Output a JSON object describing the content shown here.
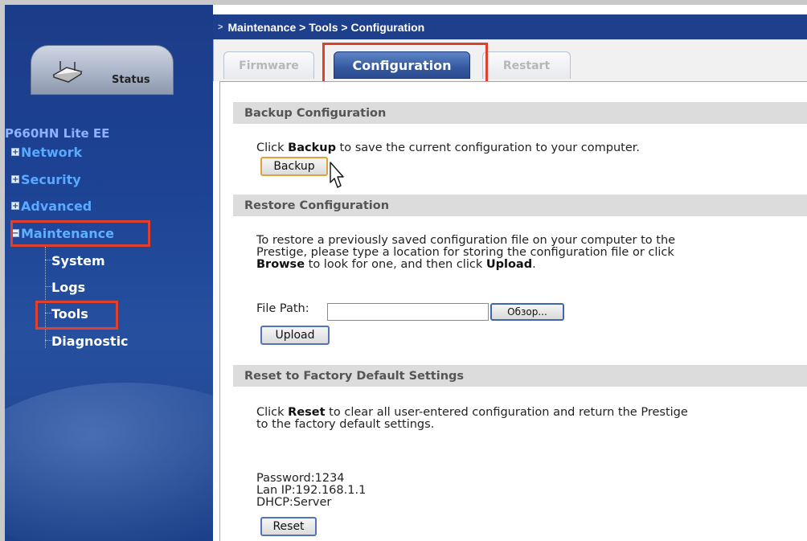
{
  "breadcrumb": "Maintenance > Tools > Configuration",
  "status_tab": {
    "label": "Status",
    "icon": "router-icon"
  },
  "sidebar": {
    "device_name": "P660HN Lite EE",
    "items": [
      {
        "label": "Network"
      },
      {
        "label": "Security"
      },
      {
        "label": "Advanced"
      },
      {
        "label": "Maintenance"
      }
    ],
    "subitems": [
      {
        "label": "System"
      },
      {
        "label": "Logs"
      },
      {
        "label": "Tools"
      },
      {
        "label": "Diagnostic"
      }
    ]
  },
  "tabs": [
    {
      "label": "Firmware",
      "active": false
    },
    {
      "label": "Configuration",
      "active": true
    },
    {
      "label": "Restart",
      "active": false
    }
  ],
  "backup": {
    "header": "Backup Configuration",
    "text_pre": "Click ",
    "text_bold": "Backup",
    "text_post": " to save the current configuration to your computer.",
    "button": "Backup"
  },
  "restore": {
    "header": "Restore Configuration",
    "line1": "To restore a previously saved configuration file on your computer to the",
    "line2": "Prestige, please type a location for storing the configuration file or click",
    "line3_bold1": "Browse",
    "line3_mid": " to look for one, and then click ",
    "line3_bold2": "Upload",
    "line3_end": ".",
    "file_path_label": "File Path:",
    "file_path_value": "",
    "browse_button": "Обзор...",
    "upload_button": "Upload"
  },
  "reset": {
    "header": "Reset to Factory Default Settings",
    "line1_pre": "Click ",
    "line1_bold": "Reset",
    "line1_post": " to clear all user-entered configuration and return the Prestige",
    "line2": "to the factory default settings.",
    "password": "Password:1234",
    "lan_ip": "Lan IP:192.168.1.1",
    "dhcp": "DHCP:Server",
    "button": "Reset"
  },
  "colors": {
    "sidebar": "#1d4395",
    "highlight": "#e0412e",
    "nav_text": "#58a9ff",
    "active_tab": "#34589f"
  }
}
